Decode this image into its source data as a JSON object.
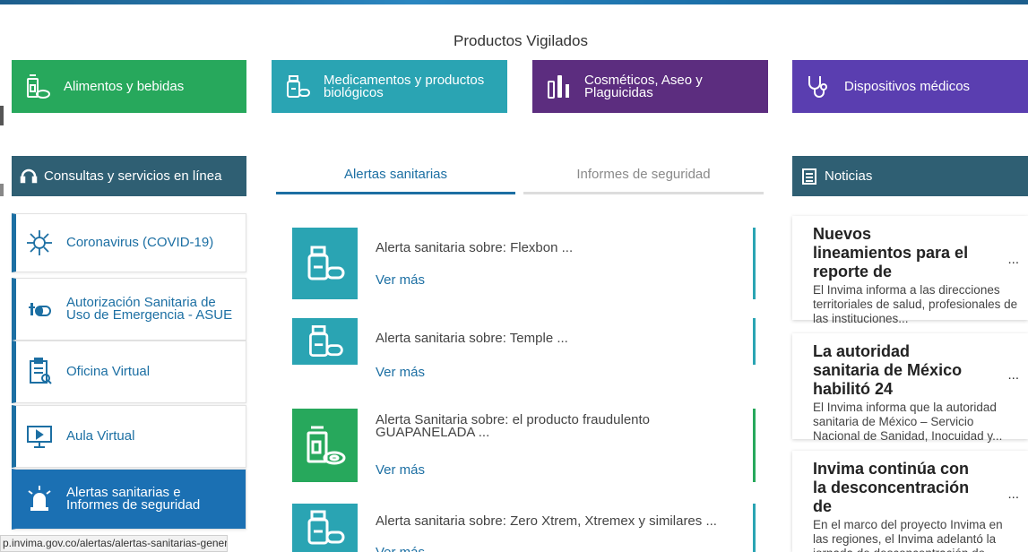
{
  "section_title": "Productos Vigilados",
  "products": [
    {
      "label": "Alimentos y bebidas",
      "icon": "food-drink-icon",
      "color": "#27a85c"
    },
    {
      "label": "Medicamentos y productos\nbiológicos",
      "icon": "medicine-icon",
      "color": "#2aa4b3"
    },
    {
      "label": "Cosméticos, Aseo y\nPlaguicidas",
      "icon": "cosmetics-icon",
      "color": "#5c2d7f"
    },
    {
      "label": "Dispositivos médicos",
      "icon": "stethoscope-icon",
      "color": "#5a3eb0"
    }
  ],
  "services": {
    "title": "Consultas y servicios en línea",
    "items": [
      {
        "label": "Coronavirus (COVID-19)",
        "icon": "virus-icon"
      },
      {
        "label": "Autorización Sanitaria de\nUso de Emergencia - ASUE",
        "icon": "vaccine-icon"
      },
      {
        "label": "Oficina Virtual",
        "icon": "clipboard-icon"
      },
      {
        "label": "Aula Virtual",
        "icon": "monitor-icon"
      },
      {
        "label": "Alertas sanitarias e\nInformes de seguridad",
        "icon": "siren-icon"
      }
    ]
  },
  "tabs": [
    "Alertas sanitarias",
    "Informes de seguridad"
  ],
  "alerts": [
    {
      "title": "Alerta sanitaria sobre: Flexbon ...",
      "more": "Ver más"
    },
    {
      "title": "Alerta sanitaria sobre: Temple ...",
      "more": "Ver más"
    },
    {
      "title": "Alerta Sanitaria sobre: el producto fraudulento\nGUAPANELADA ...",
      "more": "Ver más"
    },
    {
      "title": "Alerta sanitaria sobre: Zero Xtrem, Xtremex y similares ...",
      "more": "Ver más"
    }
  ],
  "news": {
    "title": "Noticias",
    "items": [
      {
        "title": "Nuevos lineamientos para el reporte de",
        "more": "...",
        "text": "El Invima informa a las direcciones territoriales de salud, profesionales de las instituciones..."
      },
      {
        "title": "La autoridad sanitaria de México habilitó 24",
        "more": "...",
        "text": "El Invima informa que la autoridad sanitaria de México – Servicio Nacional de Sanidad, Inocuidad y..."
      },
      {
        "title": "Invima continúa con la desconcentración de",
        "more": "...",
        "text": "En el marco del proyecto Invima en las regiones, el Invima adelantó la jornada de desconcentración de..."
      }
    ]
  },
  "status_url": "p.invima.gov.co/alertas/alertas-sanitarias-general"
}
